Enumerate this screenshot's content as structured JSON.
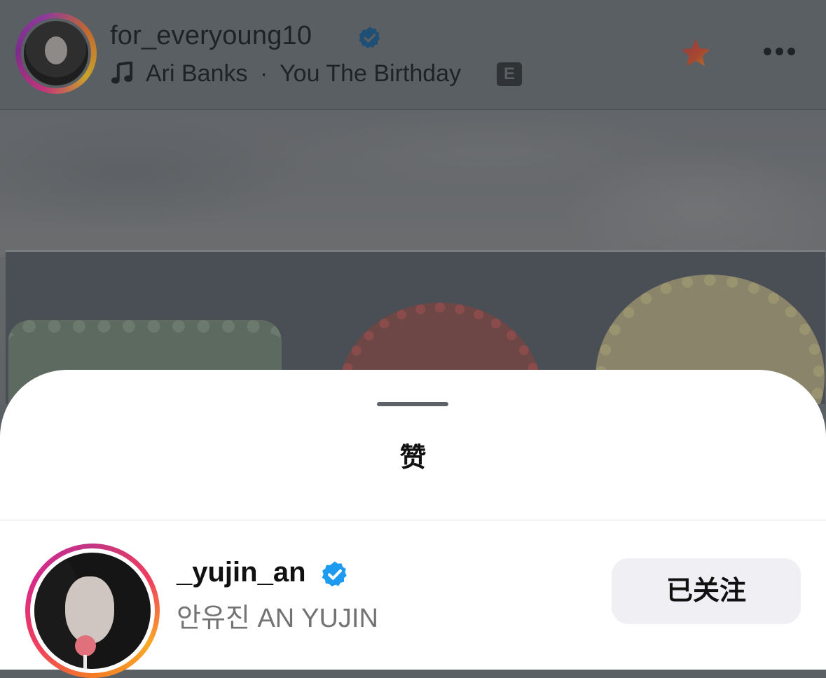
{
  "post": {
    "username": "for_everyoung10",
    "music": {
      "artist": "Ari Banks",
      "separator": "·",
      "track": "You The Birthday",
      "explicit_label": "E"
    }
  },
  "likes_sheet": {
    "title": "赞",
    "users": [
      {
        "username": "_yujin_an",
        "full_name": "안유진 AN YUJIN",
        "follow_label": "已关注",
        "verified": true
      }
    ]
  },
  "colors": {
    "verified_blue": "#1d9bf0",
    "follow_button_bg": "#efeff4",
    "dim_overlay": "#5b6064"
  },
  "icons": [
    "verified-badge-icon",
    "music-note-icon",
    "explicit-icon",
    "star-icon",
    "more-icon"
  ]
}
